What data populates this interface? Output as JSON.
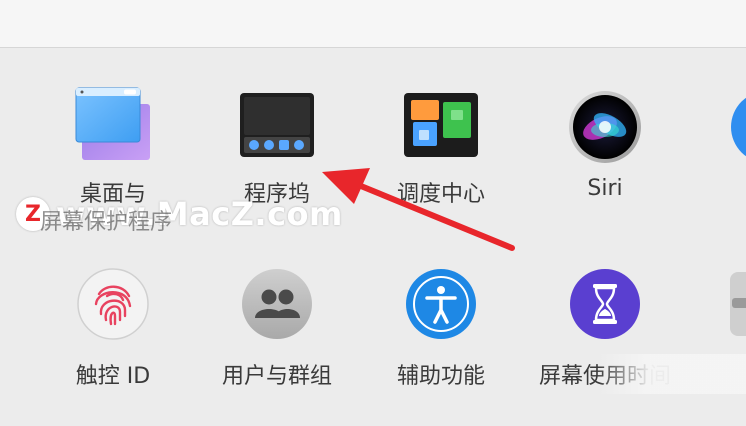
{
  "prefs": {
    "row1": [
      {
        "label": "桌面与",
        "icon": "desktop-screensaver-icon"
      },
      {
        "label": "程序坞",
        "icon": "dock-icon"
      },
      {
        "label": "调度中心",
        "icon": "mission-control-icon"
      },
      {
        "label": "Siri",
        "icon": "siri-icon"
      }
    ],
    "row1_partial_label": "屏幕保护程序",
    "row2": [
      {
        "label": "触控 ID",
        "icon": "touch-id-icon"
      },
      {
        "label": "用户与群组",
        "icon": "users-groups-icon"
      },
      {
        "label": "辅助功能",
        "icon": "accessibility-icon"
      },
      {
        "label": "屏幕使用时间",
        "icon": "screen-time-icon"
      }
    ]
  },
  "watermark": {
    "text": "www.MacZ.com",
    "logo_letter": "Z"
  },
  "colors": {
    "arrow": "#e8262b",
    "accent_blue": "#1e88e5"
  }
}
